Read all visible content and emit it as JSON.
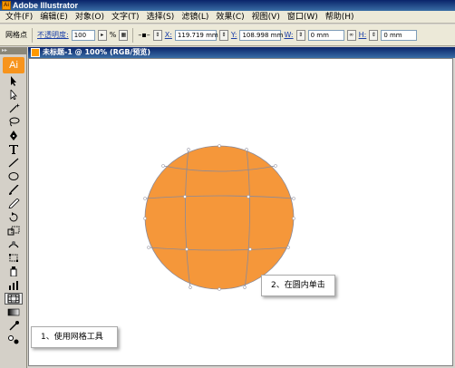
{
  "app": {
    "title": "Adobe Illustrator",
    "icon": "ai-app-icon"
  },
  "menu": [
    "文件(F)",
    "编辑(E)",
    "对象(O)",
    "文字(T)",
    "选择(S)",
    "滤镜(L)",
    "效果(C)",
    "视图(V)",
    "窗口(W)",
    "帮助(H)"
  ],
  "control": {
    "tool_name": "网格点",
    "opacity_label": "不透明度:",
    "opacity_value": "100",
    "opacity_unit": "%",
    "x_label": "X:",
    "x_value": "119.719 mm",
    "y_label": "Y:",
    "y_value": "108.998 mm",
    "w_label": "W:",
    "w_value": "0 mm",
    "h_label": "H:",
    "h_value": "0 mm"
  },
  "toolbox": {
    "logo": "Ai"
  },
  "document": {
    "title": "未标题-1 @ 100% (RGB/预览)"
  },
  "mesh": {
    "fill": "#f5973a",
    "stroke": "#8a8a9a"
  },
  "callouts": {
    "step1": "1、使用网格工具",
    "step2": "2、在圆内单击"
  }
}
